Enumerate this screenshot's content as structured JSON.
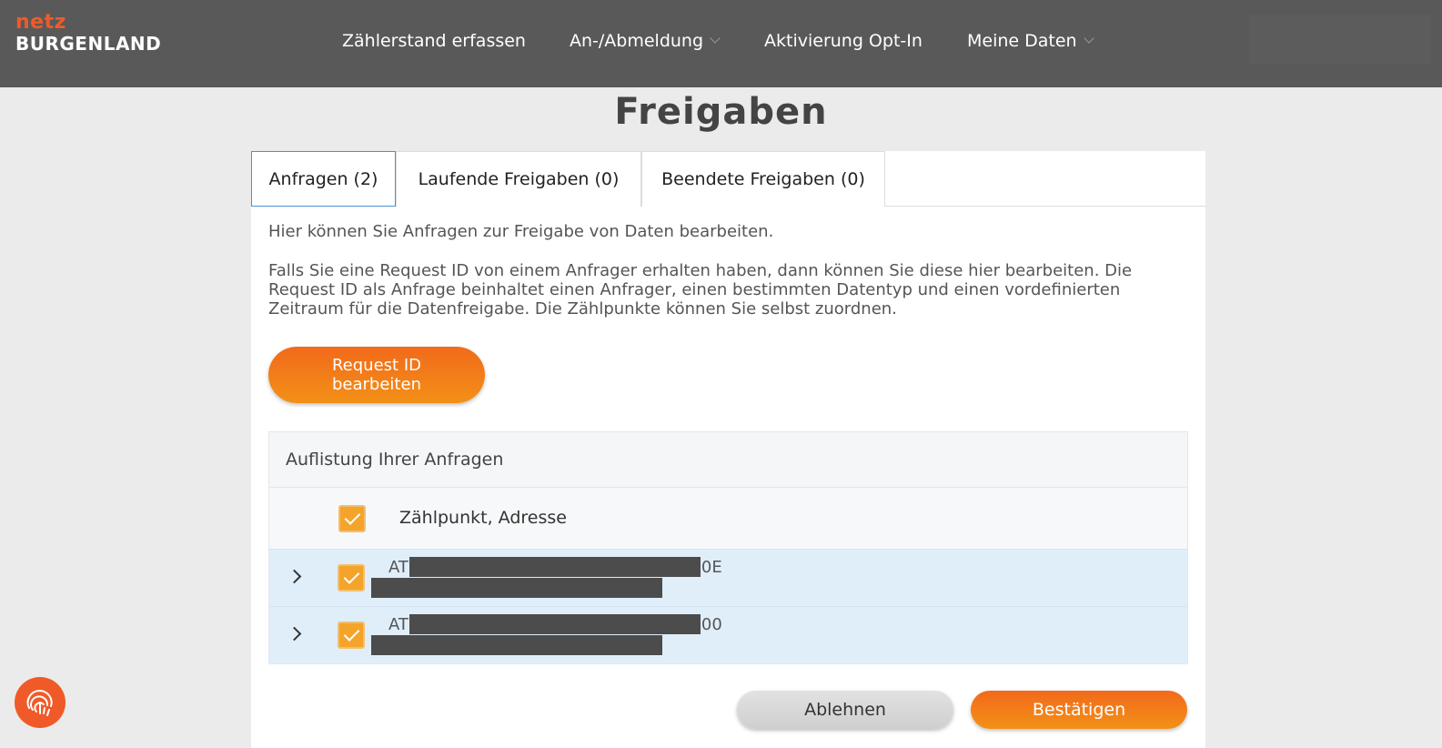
{
  "header": {
    "logo_top": "netz",
    "logo_bottom": "BURGENLAND",
    "nav": [
      {
        "label": "Zählerstand erfassen",
        "dropdown": false
      },
      {
        "label": "An-/Abmeldung",
        "dropdown": true
      },
      {
        "label": "Aktivierung Opt-In",
        "dropdown": false
      },
      {
        "label": "Meine Daten",
        "dropdown": true
      }
    ]
  },
  "page": {
    "title": "Freigaben"
  },
  "tabs": [
    {
      "label": "Anfragen (2)",
      "active": true
    },
    {
      "label": "Laufende Freigaben (0)",
      "active": false
    },
    {
      "label": "Beendete Freigaben (0)",
      "active": false
    }
  ],
  "content": {
    "intro1": "Hier können Sie Anfragen zur Freigabe von Daten bearbeiten.",
    "intro2": "Falls Sie eine Request ID von einem Anfrager erhalten haben, dann können Sie diese hier bearbeiten. Die Request ID als Anfrage beinhaltet einen Anfrager, einen bestimmten Datentyp und einen vordefinierten Zeitraum für die Datenfreigabe. Die Zählpunkte können Sie selbst zuordnen.",
    "request_button_line1": "Request ID",
    "request_button_line2": "bearbeiten"
  },
  "list": {
    "header": "Auflistung Ihrer Anfragen",
    "column_label": "Zählpunkt, Adresse",
    "select_all_checked": true,
    "rows": [
      {
        "id_prefix": "AT",
        "id_suffix": "0E",
        "checked": true
      },
      {
        "id_prefix": "AT",
        "id_suffix": "00",
        "checked": true
      }
    ]
  },
  "actions": {
    "reject": "Ablehnen",
    "confirm": "Bestätigen"
  },
  "colors": {
    "header_bg": "#595959",
    "accent_orange": "#f26a1b",
    "active_tab_border": "#4a90d9",
    "row_bg": "#e0eefa"
  },
  "icons": {
    "floating": "fingerprint-icon",
    "expand": "chevron-right-icon",
    "dropdown": "chevron-down-icon"
  }
}
